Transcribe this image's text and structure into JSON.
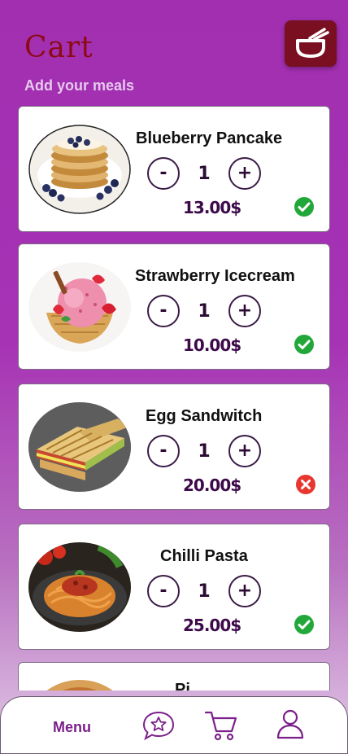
{
  "header": {
    "title": "Cart",
    "subtitle": "Add your meals",
    "app_icon": "bowl-icon"
  },
  "cart_items": [
    {
      "name": "Blueberry Pancake",
      "quantity": "1",
      "price": "13.00$",
      "minus_label": "-",
      "plus_label": "+",
      "status": "available",
      "status_icon": "check-circle-icon"
    },
    {
      "name": "Strawberry Icecream",
      "quantity": "1",
      "price": "10.00$",
      "minus_label": "-",
      "plus_label": "+",
      "status": "available",
      "status_icon": "check-circle-icon"
    },
    {
      "name": "Egg Sandwitch",
      "quantity": "1",
      "price": "20.00$",
      "minus_label": "-",
      "plus_label": "+",
      "status": "unavailable",
      "status_icon": "x-circle-icon"
    },
    {
      "name": "Chilli Pasta",
      "quantity": "1",
      "price": "25.00$",
      "minus_label": "-",
      "plus_label": "+",
      "status": "available",
      "status_icon": "check-circle-icon"
    },
    {
      "name": "Pi",
      "partial": true
    }
  ],
  "bottom_nav": {
    "menu_label": "Menu",
    "items": [
      "menu",
      "reviews-star-chat-icon",
      "cart-icon",
      "profile-icon"
    ]
  },
  "colors": {
    "background_top": "#a12fb0",
    "background_bottom": "#e2cbe6",
    "title": "#8b0a14",
    "subtitle": "#e6c9ee",
    "price": "#3d0a4a",
    "check": "#22a83a",
    "cross": "#e8372f",
    "nav_accent": "#7b1f8a",
    "app_badge": "#7a0f22"
  }
}
